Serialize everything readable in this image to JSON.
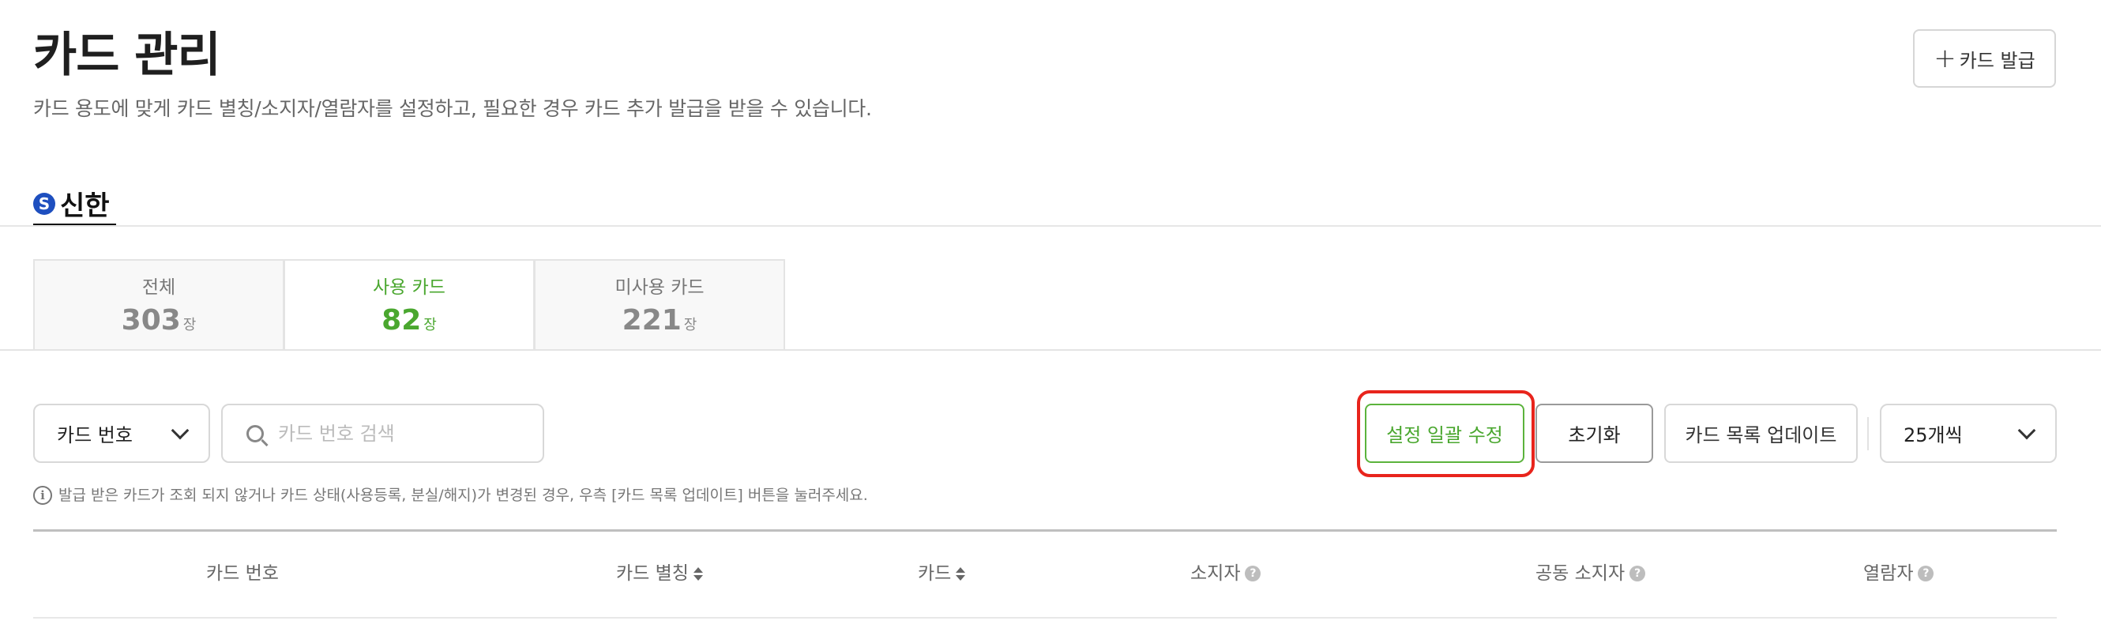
{
  "header": {
    "title": "카드 관리",
    "description": "카드 용도에 맞게 카드 별칭/소지자/열람자를 설정하고, 필요한 경우 카드 추가 발급을 받을 수 있습니다.",
    "issue_button": {
      "icon": "plus-icon",
      "label": "카드 발급"
    }
  },
  "bank": {
    "logo": "shinhan-logo",
    "label": "신한"
  },
  "summary_tabs": [
    {
      "label": "전체",
      "count": "303",
      "unit": "장",
      "active": false
    },
    {
      "label": "사용 카드",
      "count": "82",
      "unit": "장",
      "active": true
    },
    {
      "label": "미사용 카드",
      "count": "221",
      "unit": "장",
      "active": false
    }
  ],
  "filters": {
    "search_type": {
      "selected": "카드 번호",
      "icon": "chevron-down-icon"
    },
    "search": {
      "placeholder": "카드 번호 검색",
      "value": "",
      "icon": "search-icon"
    },
    "bulk_edit_label": "설정 일괄 수정",
    "reset_label": "초기화",
    "update_label": "카드 목록 업데이트",
    "page_size": {
      "selected": "25개씩",
      "icon": "chevron-down-icon"
    }
  },
  "notice": {
    "icon": "info-icon",
    "text": "발급 받은 카드가 조회 되지 않거나 카드 상태(사용등록, 분실/해지)가 변경된 경우, 우측 [카드 목록 업데이트] 버튼을 눌러주세요."
  },
  "table": {
    "columns": [
      {
        "label": "카드 번호",
        "sortable": false,
        "help": false
      },
      {
        "label": "카드 별칭",
        "sortable": true,
        "help": false
      },
      {
        "label": "카드",
        "sortable": true,
        "help": false
      },
      {
        "label": "소지자",
        "sortable": false,
        "help": true
      },
      {
        "label": "공동 소지자",
        "sortable": false,
        "help": true
      },
      {
        "label": "열람자",
        "sortable": false,
        "help": true
      }
    ],
    "help_glyph": "?"
  },
  "colors": {
    "accent_green": "#4aa72f",
    "highlight_red": "#e8241c",
    "shinhan_blue": "#1e4fbf"
  }
}
